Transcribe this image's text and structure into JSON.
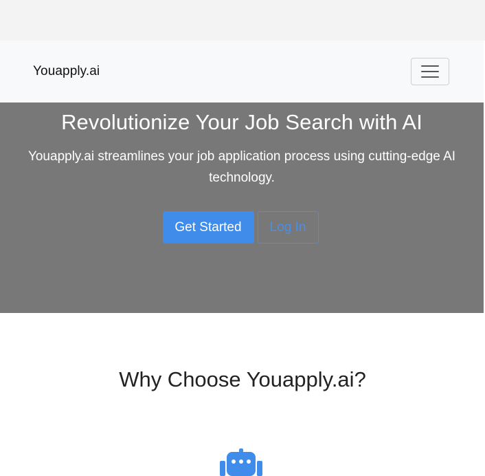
{
  "navbar": {
    "brand": "Youapply.ai",
    "toggle_icon": "hamburger-menu-icon"
  },
  "hero": {
    "title": "Revolutionize Your Job Search with AI",
    "subtitle": "Youapply.ai streamlines your job application process using cutting-edge AI technology.",
    "primary_button": "Get Started",
    "secondary_button": "Log In"
  },
  "why": {
    "title": "Why Choose Youapply.ai?",
    "feature_icon": "robot-icon"
  },
  "colors": {
    "hero_background": "#787878",
    "navbar_background": "#f8f9fa",
    "accent": "#3f8ceb"
  }
}
